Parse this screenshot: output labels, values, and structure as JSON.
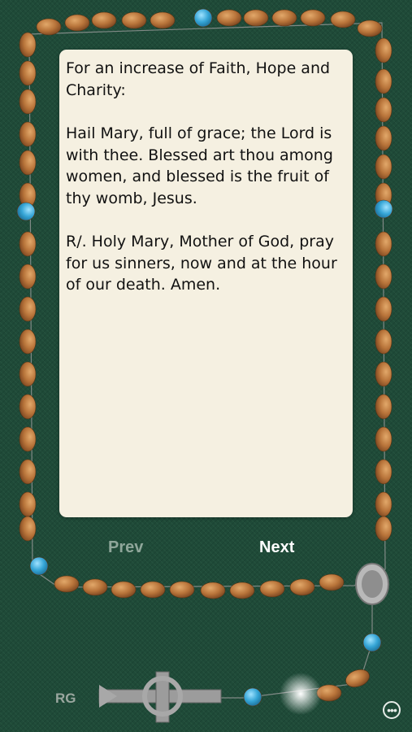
{
  "prayer": {
    "intention": "For an increase of Faith, Hope and Charity:",
    "verse": "Hail Mary, full of grace; the Lord is with thee. Blessed art thou among women, and blessed is the fruit of thy womb, Jesus.",
    "response": "R/. Holy Mary, Mother of God, pray for us sinners, now and at the hour of our death. Amen."
  },
  "nav": {
    "prev_label": "Prev",
    "next_label": "Next"
  },
  "footer": {
    "badge": "RG",
    "more_icon": "more-icon"
  },
  "colors": {
    "background": "#1f4a38",
    "bead_wood": "#b8743a",
    "bead_blue": "#35a5d6",
    "next": "#ffffff",
    "prev": "#8fa69a"
  }
}
